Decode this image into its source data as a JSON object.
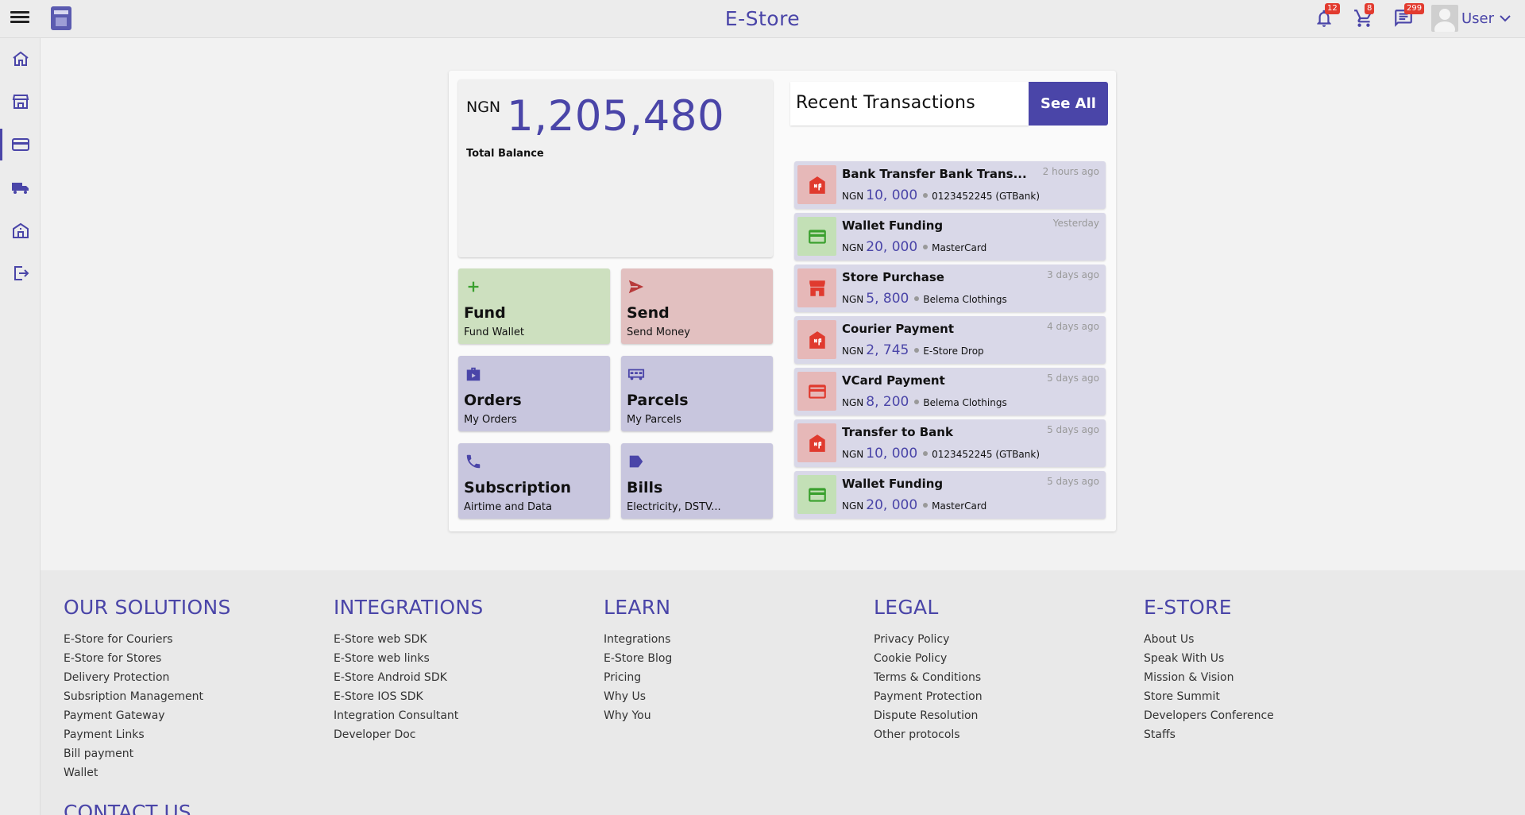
{
  "header": {
    "title": "E-Store",
    "notifications_count": "12",
    "cart_count": "8",
    "messages_count": "299",
    "user_label": "User"
  },
  "sidebar": {
    "items": [
      {
        "icon": "home-icon"
      },
      {
        "icon": "store-icon"
      },
      {
        "icon": "wallet-card-icon",
        "active": true
      },
      {
        "icon": "delivery-truck-icon"
      },
      {
        "icon": "bank-icon"
      },
      {
        "icon": "logout-icon"
      }
    ]
  },
  "balance": {
    "currency": "NGN",
    "amount": "1,205,480",
    "label": "Total Balance"
  },
  "actions": [
    {
      "title": "Fund",
      "subtitle": "Fund Wallet",
      "icon": "plus-icon",
      "color": "#cde0bf"
    },
    {
      "title": "Send",
      "subtitle": "Send Money",
      "icon": "send-icon",
      "color": "#e2c0c0"
    },
    {
      "title": "Orders",
      "subtitle": "My Orders",
      "icon": "briefcase-icon",
      "color": "#c8c6de"
    },
    {
      "title": "Parcels",
      "subtitle": "My Parcels",
      "icon": "truck-icon",
      "color": "#c8c6de"
    },
    {
      "title": "Subscription",
      "subtitle": "Airtime and Data",
      "icon": "phone-icon",
      "color": "#c8c6de"
    },
    {
      "title": "Bills",
      "subtitle": "Electricity, DSTV...",
      "icon": "tag-icon",
      "color": "#c8c6de"
    }
  ],
  "transactions": {
    "title": "Recent Transactions",
    "see_all": "See All",
    "items": [
      {
        "name": "Bank Transfer Bank Trans...",
        "time": "2 hours ago",
        "currency": "NGN",
        "amount": "10, 000",
        "dest": "0123452245 (GTBank)",
        "icon": "bank-transfer-icon",
        "tone": "red"
      },
      {
        "name": "Wallet Funding",
        "time": "Yesterday",
        "currency": "NGN",
        "amount": "20, 000",
        "dest": "MasterCard",
        "icon": "credit-card-icon",
        "tone": "green"
      },
      {
        "name": "Store Purchase",
        "time": "3 days ago",
        "currency": "NGN",
        "amount": "5, 800",
        "dest": "Belema Clothings",
        "icon": "store-icon",
        "tone": "red"
      },
      {
        "name": "Courier Payment",
        "time": "4 days ago",
        "currency": "NGN",
        "amount": "2, 745",
        "dest": "E-Store Drop",
        "icon": "bank-transfer-icon",
        "tone": "red"
      },
      {
        "name": "VCard Payment",
        "time": "5 days ago",
        "currency": "NGN",
        "amount": "8, 200",
        "dest": "Belema Clothings",
        "icon": "credit-card-icon",
        "tone": "red"
      },
      {
        "name": "Transfer to Bank",
        "time": "5 days ago",
        "currency": "NGN",
        "amount": "10, 000",
        "dest": "0123452245 (GTBank)",
        "icon": "bank-transfer-icon",
        "tone": "red"
      },
      {
        "name": "Wallet Funding",
        "time": "5 days ago",
        "currency": "NGN",
        "amount": "20, 000",
        "dest": "MasterCard",
        "icon": "credit-card-icon",
        "tone": "green"
      }
    ]
  },
  "footer": {
    "columns": [
      {
        "title": "OUR SOLUTIONS",
        "links": [
          "E-Store for Couriers",
          "E-Store for Stores",
          "Delivery Protection",
          "Subsription Management",
          "Payment Gateway",
          "Payment Links",
          "Bill payment",
          "Wallet"
        ]
      },
      {
        "title": "INTEGRATIONS",
        "links": [
          "E-Store web SDK",
          "E-Store web links",
          "E-Store Android SDK",
          "E-Store IOS SDK",
          "Integration Consultant",
          "Developer Doc"
        ]
      },
      {
        "title": "LEARN",
        "links": [
          "Integrations",
          "E-Store Blog",
          "Pricing",
          "Why Us",
          "Why You"
        ]
      },
      {
        "title": "LEGAL",
        "links": [
          "Privacy Policy",
          "Cookie Policy",
          "Terms & Conditions",
          "Payment Protection",
          "Dispute Resolution",
          "Other protocols"
        ]
      },
      {
        "title": "E-STORE",
        "links": [
          "About Us",
          "Speak With Us",
          "Mission & Vision",
          "Store Summit",
          "Developers Conference",
          "Staffs"
        ]
      }
    ],
    "contact_title": "CONTACT US"
  },
  "colors": {
    "accent": "#4a45a8",
    "badge": "#e23b2f",
    "tx_red": "#e03a2e",
    "tx_green": "#3aa02e"
  }
}
